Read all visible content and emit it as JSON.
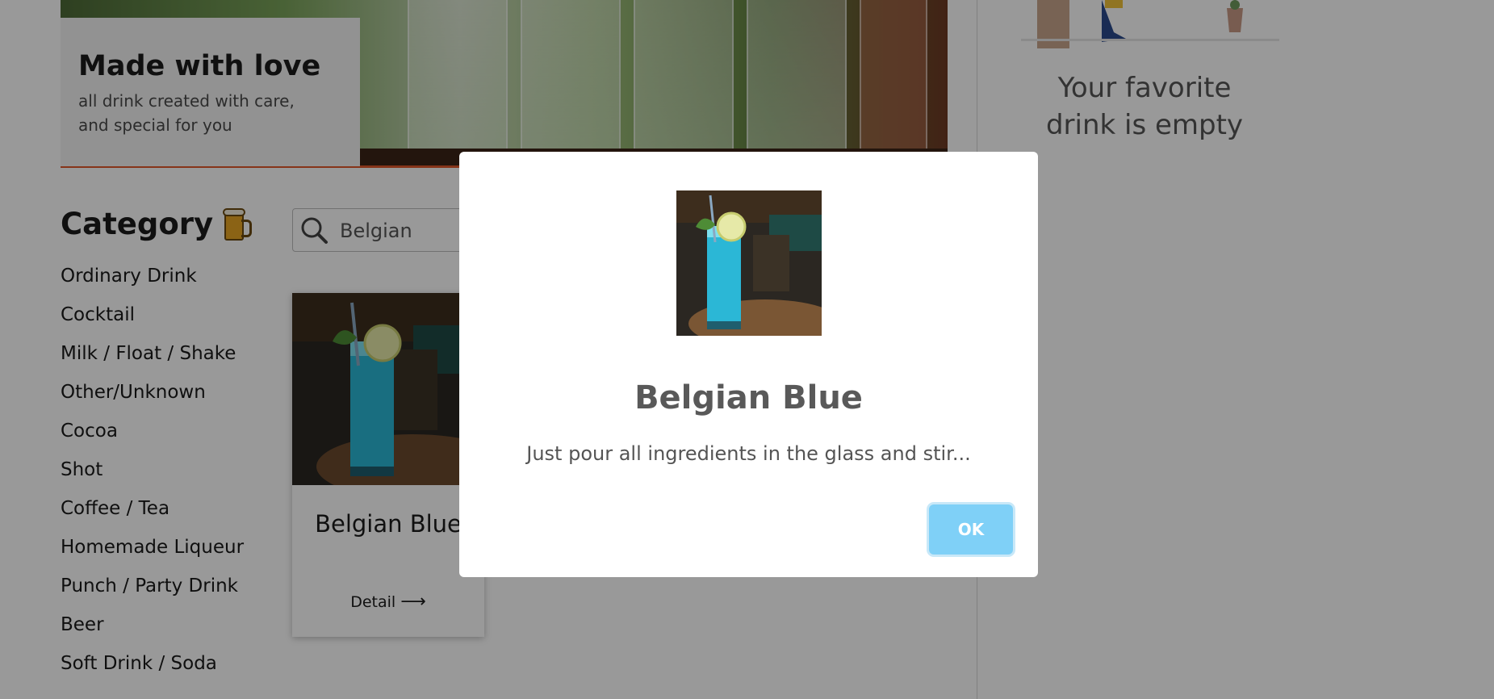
{
  "hero": {
    "title": "Made with love",
    "subtitle": "all drink created with care, and special for you"
  },
  "category": {
    "title": "Category",
    "icon": "beer-mug-icon",
    "items": [
      {
        "label": "Ordinary Drink"
      },
      {
        "label": "Cocktail"
      },
      {
        "label": "Milk / Float / Shake"
      },
      {
        "label": "Other/Unknown"
      },
      {
        "label": "Cocoa"
      },
      {
        "label": "Shot"
      },
      {
        "label": "Coffee / Tea"
      },
      {
        "label": "Homemade Liqueur"
      },
      {
        "label": "Punch / Party Drink"
      },
      {
        "label": "Beer"
      },
      {
        "label": "Soft Drink / Soda"
      }
    ]
  },
  "search": {
    "value": "Belgian",
    "icon": "search-icon"
  },
  "results": [
    {
      "title": "Belgian Blue",
      "detail_label": "Detail",
      "arrow": "⟶"
    }
  ],
  "favorites": {
    "empty_text": "Your favorite drink is empty"
  },
  "modal": {
    "title": "Belgian Blue",
    "text": "Just pour all ingredients in the glass and stir...",
    "ok_label": "OK"
  },
  "colors": {
    "accent_line": "#e0572a",
    "ok_button": "#7fd0f7",
    "drink_blue": "#2bb7d6"
  }
}
